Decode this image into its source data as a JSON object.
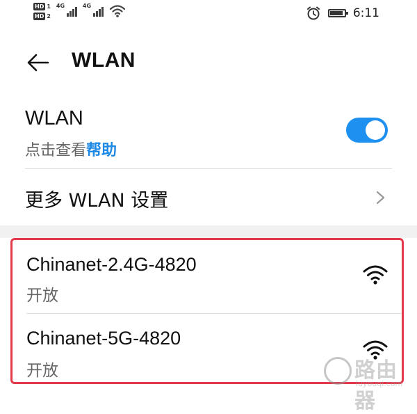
{
  "status_bar": {
    "sim1": "HD",
    "sim1_slot": "1",
    "sim2": "HD",
    "sim2_slot": "2",
    "network1": "4G",
    "network2": "4G",
    "time": "6:11",
    "icons": [
      "signal-icon",
      "wifi-icon",
      "alarm-icon",
      "battery-icon"
    ],
    "battery_level": 0.9
  },
  "header": {
    "back_icon": "arrow-left-icon",
    "title": "WLAN"
  },
  "wlan_toggle": {
    "label": "WLAN",
    "hint_prefix": "点击查看",
    "hint_link": "帮助",
    "enabled": true,
    "accent_color": "#1e90ef"
  },
  "more_settings": {
    "label": "更多 WLAN 设置",
    "chevron_icon": "chevron-right-icon"
  },
  "networks": [
    {
      "name": "Chinanet-2.4G-4820",
      "status": "开放",
      "icon": "wifi-icon"
    },
    {
      "name": "Chinanet-5G-4820",
      "status": "开放",
      "icon": "wifi-icon"
    }
  ],
  "highlight_color": "#e23a4a",
  "watermark": {
    "text": "路由器",
    "url": "luyouqi.com"
  }
}
